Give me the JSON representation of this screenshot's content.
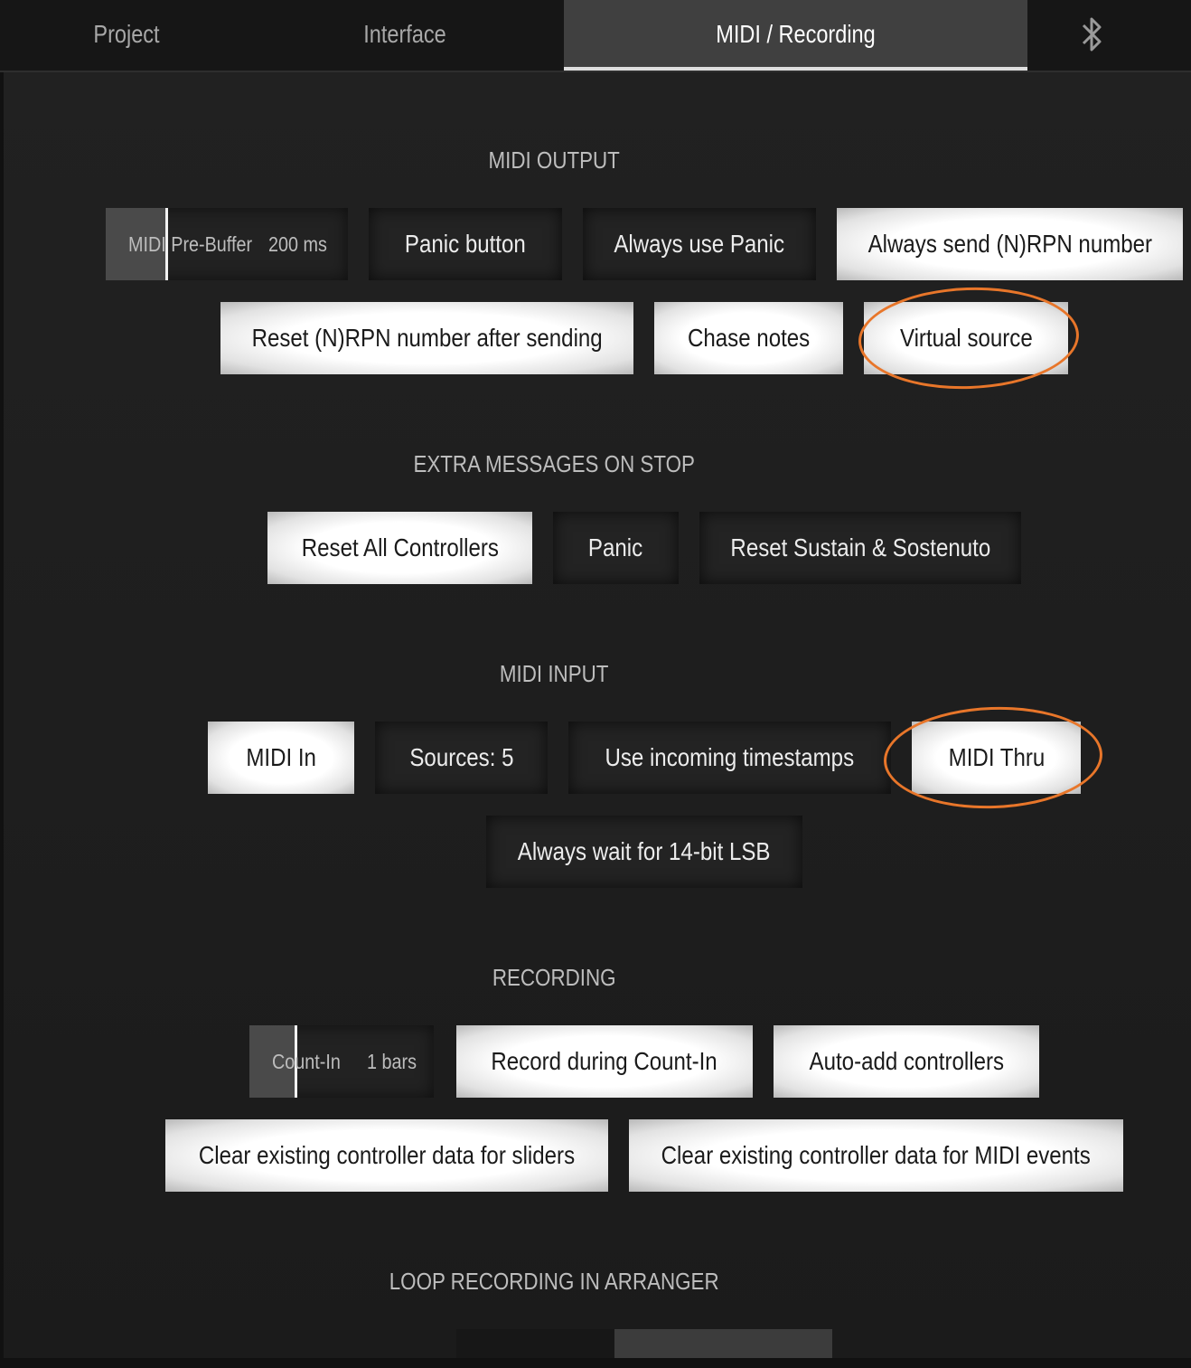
{
  "tabs": [
    {
      "label": "Project"
    },
    {
      "label": "Interface"
    },
    {
      "label": "MIDI / Recording",
      "active": true
    }
  ],
  "bluetooth_icon": "bluetooth-icon",
  "accent_color": "#e8762a",
  "sections": {
    "midi_output": {
      "title": "MIDI OUTPUT",
      "prebuffer": {
        "label": "MIDI Pre-Buffer",
        "value": "200 ms"
      },
      "panic_button": "Panic button",
      "always_use_panic": "Always use Panic",
      "always_send_nrpn": "Always send (N)RPN number",
      "reset_nrpn": "Reset (N)RPN number after sending",
      "chase_notes": "Chase notes",
      "virtual_source": "Virtual source"
    },
    "extra_messages": {
      "title": "EXTRA MESSAGES ON STOP",
      "reset_all_controllers": "Reset All Controllers",
      "panic": "Panic",
      "reset_sustain": "Reset Sustain & Sostenuto"
    },
    "midi_input": {
      "title": "MIDI INPUT",
      "midi_in": "MIDI In",
      "sources": "Sources: 5",
      "use_timestamps": "Use incoming timestamps",
      "midi_thru": "MIDI Thru",
      "wait_14bit": "Always wait for 14-bit LSB"
    },
    "recording": {
      "title": "RECORDING",
      "countin": {
        "label": "Count-In",
        "value": "1 bars"
      },
      "record_during_countin": "Record during Count-In",
      "auto_add_controllers": "Auto-add controllers",
      "clear_sliders": "Clear existing controller data for sliders",
      "clear_midi_events": "Clear existing controller data for MIDI events"
    },
    "loop_recording": {
      "title": "LOOP RECORDING IN ARRANGER"
    }
  }
}
